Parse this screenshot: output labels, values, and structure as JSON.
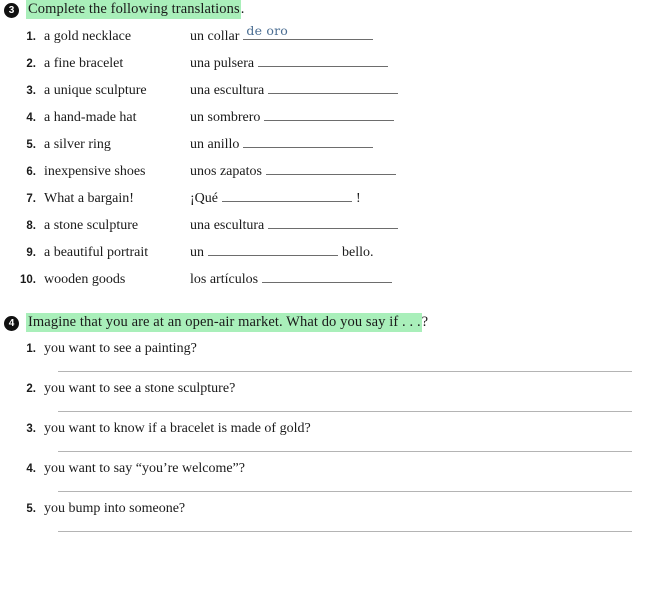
{
  "exercise3": {
    "number": "3",
    "instruction_highlight": "Complete the following translations",
    "instruction_tail": ".",
    "items": [
      {
        "num": "1.",
        "english": "a gold necklace",
        "spanish_before": "un collar",
        "answer": "de oro",
        "spanish_after": ""
      },
      {
        "num": "2.",
        "english": "a fine bracelet",
        "spanish_before": "una pulsera",
        "answer": "",
        "spanish_after": ""
      },
      {
        "num": "3.",
        "english": "a unique sculpture",
        "spanish_before": "una escultura",
        "answer": "",
        "spanish_after": ""
      },
      {
        "num": "4.",
        "english": "a hand-made hat",
        "spanish_before": "un sombrero",
        "answer": "",
        "spanish_after": ""
      },
      {
        "num": "5.",
        "english": "a silver ring",
        "spanish_before": "un anillo",
        "answer": "",
        "spanish_after": ""
      },
      {
        "num": "6.",
        "english": "inexpensive shoes",
        "spanish_before": "unos zapatos",
        "answer": "",
        "spanish_after": ""
      },
      {
        "num": "7.",
        "english": "What a bargain!",
        "spanish_before": "¡Qué",
        "answer": "",
        "spanish_after": "!"
      },
      {
        "num": "8.",
        "english": "a stone sculpture",
        "spanish_before": "una escultura",
        "answer": "",
        "spanish_after": ""
      },
      {
        "num": "9.",
        "english": "a beautiful portrait",
        "spanish_before": "un",
        "answer": "",
        "spanish_after": "bello."
      },
      {
        "num": "10.",
        "english": "wooden goods",
        "spanish_before": "los artículos",
        "answer": "",
        "spanish_after": ""
      }
    ]
  },
  "exercise4": {
    "number": "4",
    "instruction_highlight": "Imagine that you are at an open-air market. What do you say if . . .",
    "instruction_tail": "?",
    "items": [
      {
        "num": "1.",
        "question": "you want to see a painting?"
      },
      {
        "num": "2.",
        "question": "you want to see a stone sculpture?"
      },
      {
        "num": "3.",
        "question": "you want to know if a bracelet is made of gold?"
      },
      {
        "num": "4.",
        "question": "you want to say “you’re welcome”?"
      },
      {
        "num": "5.",
        "question": "you bump into someone?"
      }
    ]
  },
  "colors": {
    "highlight": "#a9efba",
    "handwriting_ink": "#4a6d92",
    "rule": "#b4b4b4",
    "blank_rule": "#6d6d6d",
    "bullet": "#111111"
  }
}
